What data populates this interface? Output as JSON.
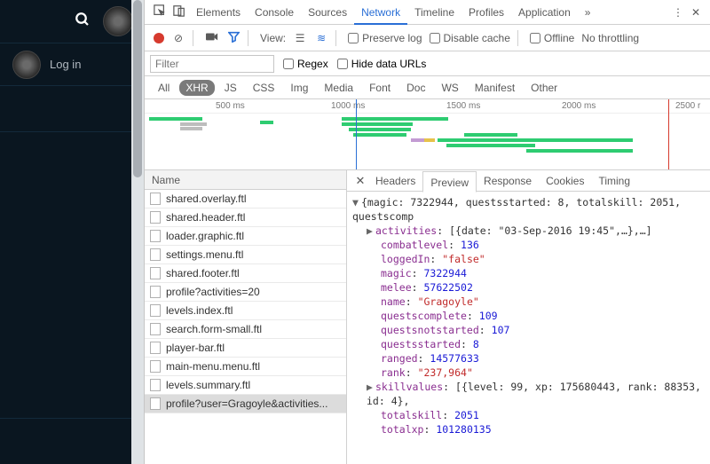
{
  "sidebar": {
    "login_label": "Log in"
  },
  "tabs": {
    "items": [
      "Elements",
      "Console",
      "Sources",
      "Network",
      "Timeline",
      "Profiles",
      "Application"
    ],
    "active": "Network",
    "more": "»"
  },
  "toolbar": {
    "view_label": "View:",
    "preserve": "Preserve log",
    "disable": "Disable cache",
    "offline": "Offline",
    "throttle": "No throttling"
  },
  "filter": {
    "placeholder": "Filter",
    "regex": "Regex",
    "hide": "Hide data URLs"
  },
  "types": [
    "All",
    "XHR",
    "JS",
    "CSS",
    "Img",
    "Media",
    "Font",
    "Doc",
    "WS",
    "Manifest",
    "Other"
  ],
  "types_selected": "XHR",
  "overview": {
    "ticks": [
      "500 ms",
      "1000 ms",
      "1500 ms",
      "2000 ms",
      "2500 r"
    ]
  },
  "reqlist": {
    "header": "Name",
    "items": [
      "shared.overlay.ftl",
      "shared.header.ftl",
      "loader.graphic.ftl",
      "settings.menu.ftl",
      "shared.footer.ftl",
      "profile?activities=20",
      "levels.index.ftl",
      "search.form-small.ftl",
      "player-bar.ftl",
      "main-menu.menu.ftl",
      "levels.summary.ftl",
      "profile?user=Gragoyle&activities..."
    ],
    "selected_index": 11
  },
  "detail_tabs": {
    "items": [
      "Headers",
      "Preview",
      "Response",
      "Cookies",
      "Timing"
    ],
    "active": "Preview"
  },
  "preview": {
    "topline": "{magic: 7322944, questsstarted: 8, totalskill: 2051, questscomp",
    "activities_key": "activities",
    "activities_val": "[{date: \"03-Sep-2016 19:45\",…},…]",
    "rows": [
      {
        "k": "combatlevel",
        "v": "136",
        "t": "num"
      },
      {
        "k": "loggedIn",
        "v": "\"false\"",
        "t": "str"
      },
      {
        "k": "magic",
        "v": "7322944",
        "t": "num"
      },
      {
        "k": "melee",
        "v": "57622502",
        "t": "num"
      },
      {
        "k": "name",
        "v": "\"Gragoyle\"",
        "t": "str"
      },
      {
        "k": "questscomplete",
        "v": "109",
        "t": "num"
      },
      {
        "k": "questsnotstarted",
        "v": "107",
        "t": "num"
      },
      {
        "k": "questsstarted",
        "v": "8",
        "t": "num"
      },
      {
        "k": "ranged",
        "v": "14577633",
        "t": "num"
      },
      {
        "k": "rank",
        "v": "\"237,964\"",
        "t": "str"
      }
    ],
    "skill_key": "skillvalues",
    "skill_val": "[{level: 99, xp: 175680443, rank: 88353, id: 4},",
    "tail": [
      {
        "k": "totalskill",
        "v": "2051",
        "t": "num"
      },
      {
        "k": "totalxp",
        "v": "101280135",
        "t": "num"
      }
    ]
  }
}
